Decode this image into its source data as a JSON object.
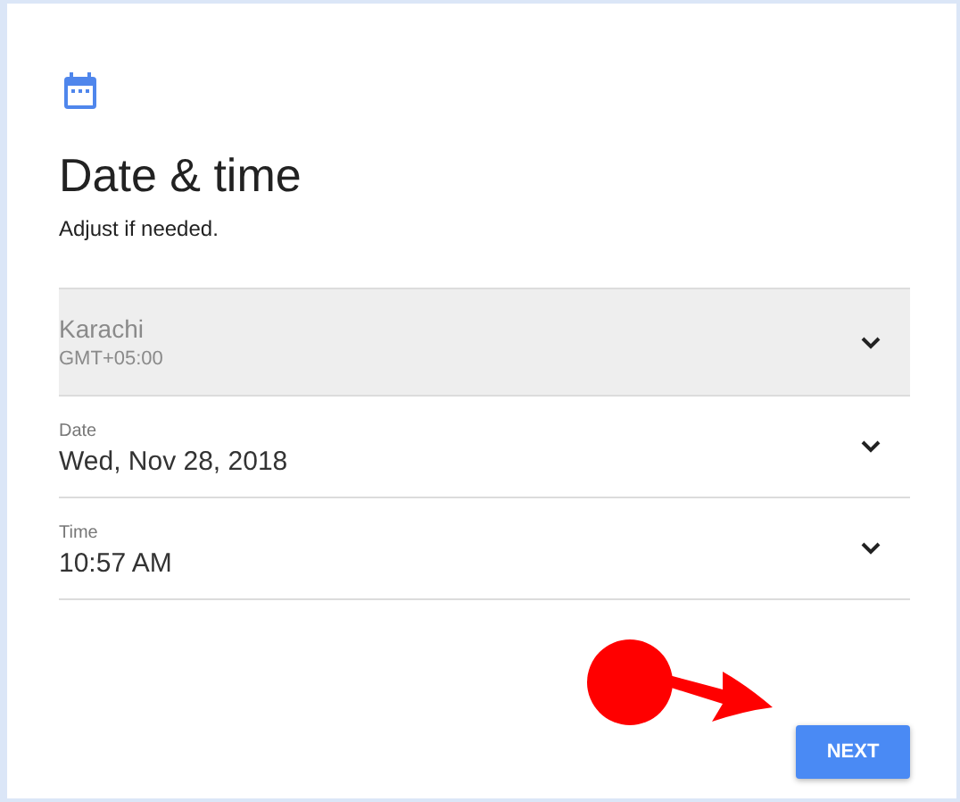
{
  "title": "Date & time",
  "subtitle": "Adjust if needed.",
  "fields": [
    {
      "label": "Karachi",
      "value": "GMT+05:00",
      "kind": "timezone",
      "disabled": true
    },
    {
      "label": "Date",
      "value": "Wed, Nov 28, 2018",
      "kind": "labeled",
      "disabled": false
    },
    {
      "label": "Time",
      "value": "10:57 AM",
      "kind": "labeled",
      "disabled": false
    }
  ],
  "next_button": "NEXT"
}
